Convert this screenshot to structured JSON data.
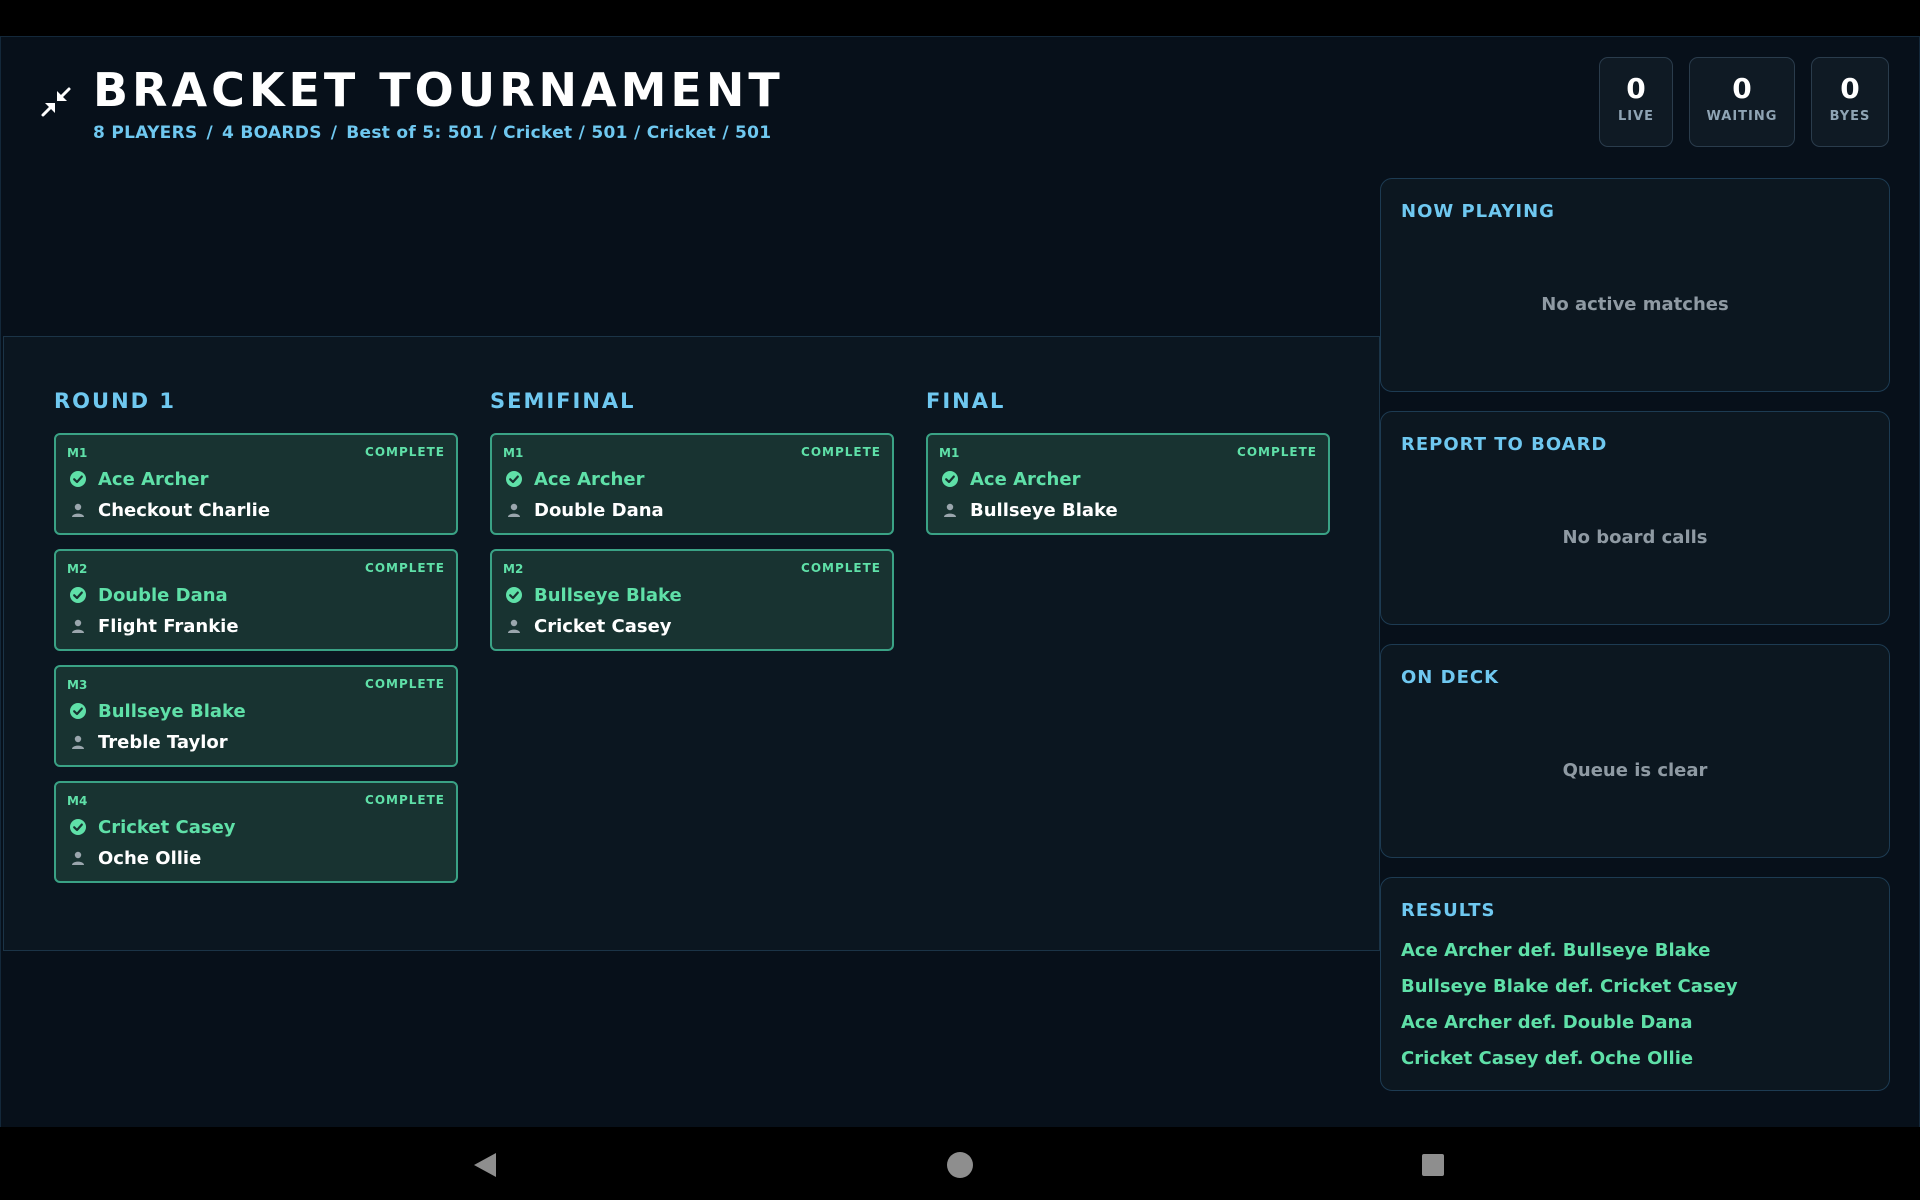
{
  "header": {
    "title": "BRACKET TOURNAMENT",
    "players": "8 PLAYERS",
    "boards": "4 BOARDS",
    "format": "Best of 5: 501 / Cricket / 501 / Cricket / 501",
    "separator": "/"
  },
  "stats": [
    {
      "value": "0",
      "label": "LIVE"
    },
    {
      "value": "0",
      "label": "WAITING"
    },
    {
      "value": "0",
      "label": "BYES"
    }
  ],
  "bracket": {
    "rounds": [
      {
        "title": "ROUND 1",
        "matches": [
          {
            "id": "M1",
            "status": "COMPLETE",
            "winner": "Ace Archer",
            "loser": "Checkout Charlie"
          },
          {
            "id": "M2",
            "status": "COMPLETE",
            "winner": "Double Dana",
            "loser": "Flight Frankie"
          },
          {
            "id": "M3",
            "status": "COMPLETE",
            "winner": "Bullseye Blake",
            "loser": "Treble Taylor"
          },
          {
            "id": "M4",
            "status": "COMPLETE",
            "winner": "Cricket Casey",
            "loser": "Oche Ollie"
          }
        ]
      },
      {
        "title": "SEMIFINAL",
        "matches": [
          {
            "id": "M1",
            "status": "COMPLETE",
            "winner": "Ace Archer",
            "loser": "Double Dana"
          },
          {
            "id": "M2",
            "status": "COMPLETE",
            "winner": "Bullseye Blake",
            "loser": "Cricket Casey"
          }
        ]
      },
      {
        "title": "FINAL",
        "matches": [
          {
            "id": "M1",
            "status": "COMPLETE",
            "winner": "Ace Archer",
            "loser": "Bullseye Blake"
          }
        ]
      }
    ]
  },
  "panels": {
    "now_playing": {
      "title": "NOW PLAYING",
      "empty": "No active matches"
    },
    "report_to_board": {
      "title": "REPORT TO BOARD",
      "empty": "No board calls"
    },
    "on_deck": {
      "title": "ON DECK",
      "empty": "Queue is clear"
    },
    "results": {
      "title": "RESULTS",
      "items": [
        "Ace Archer def. Bullseye Blake",
        "Bullseye Blake def. Cricket Casey",
        "Ace Archer def. Double Dana",
        "Cricket Casey def. Oche Ollie"
      ]
    }
  },
  "icons": {
    "collapse": "collapse-icon",
    "winner": "check-circle-icon",
    "loser": "person-icon",
    "nav_back": "back-triangle-icon",
    "nav_home": "home-circle-icon",
    "nav_recent": "recent-square-icon"
  },
  "colors": {
    "accent": "#6fc8f0",
    "winner": "#5fe0a8",
    "card_bg": "#183331",
    "card_border": "#3aa285",
    "page_bg": "#07101a"
  }
}
